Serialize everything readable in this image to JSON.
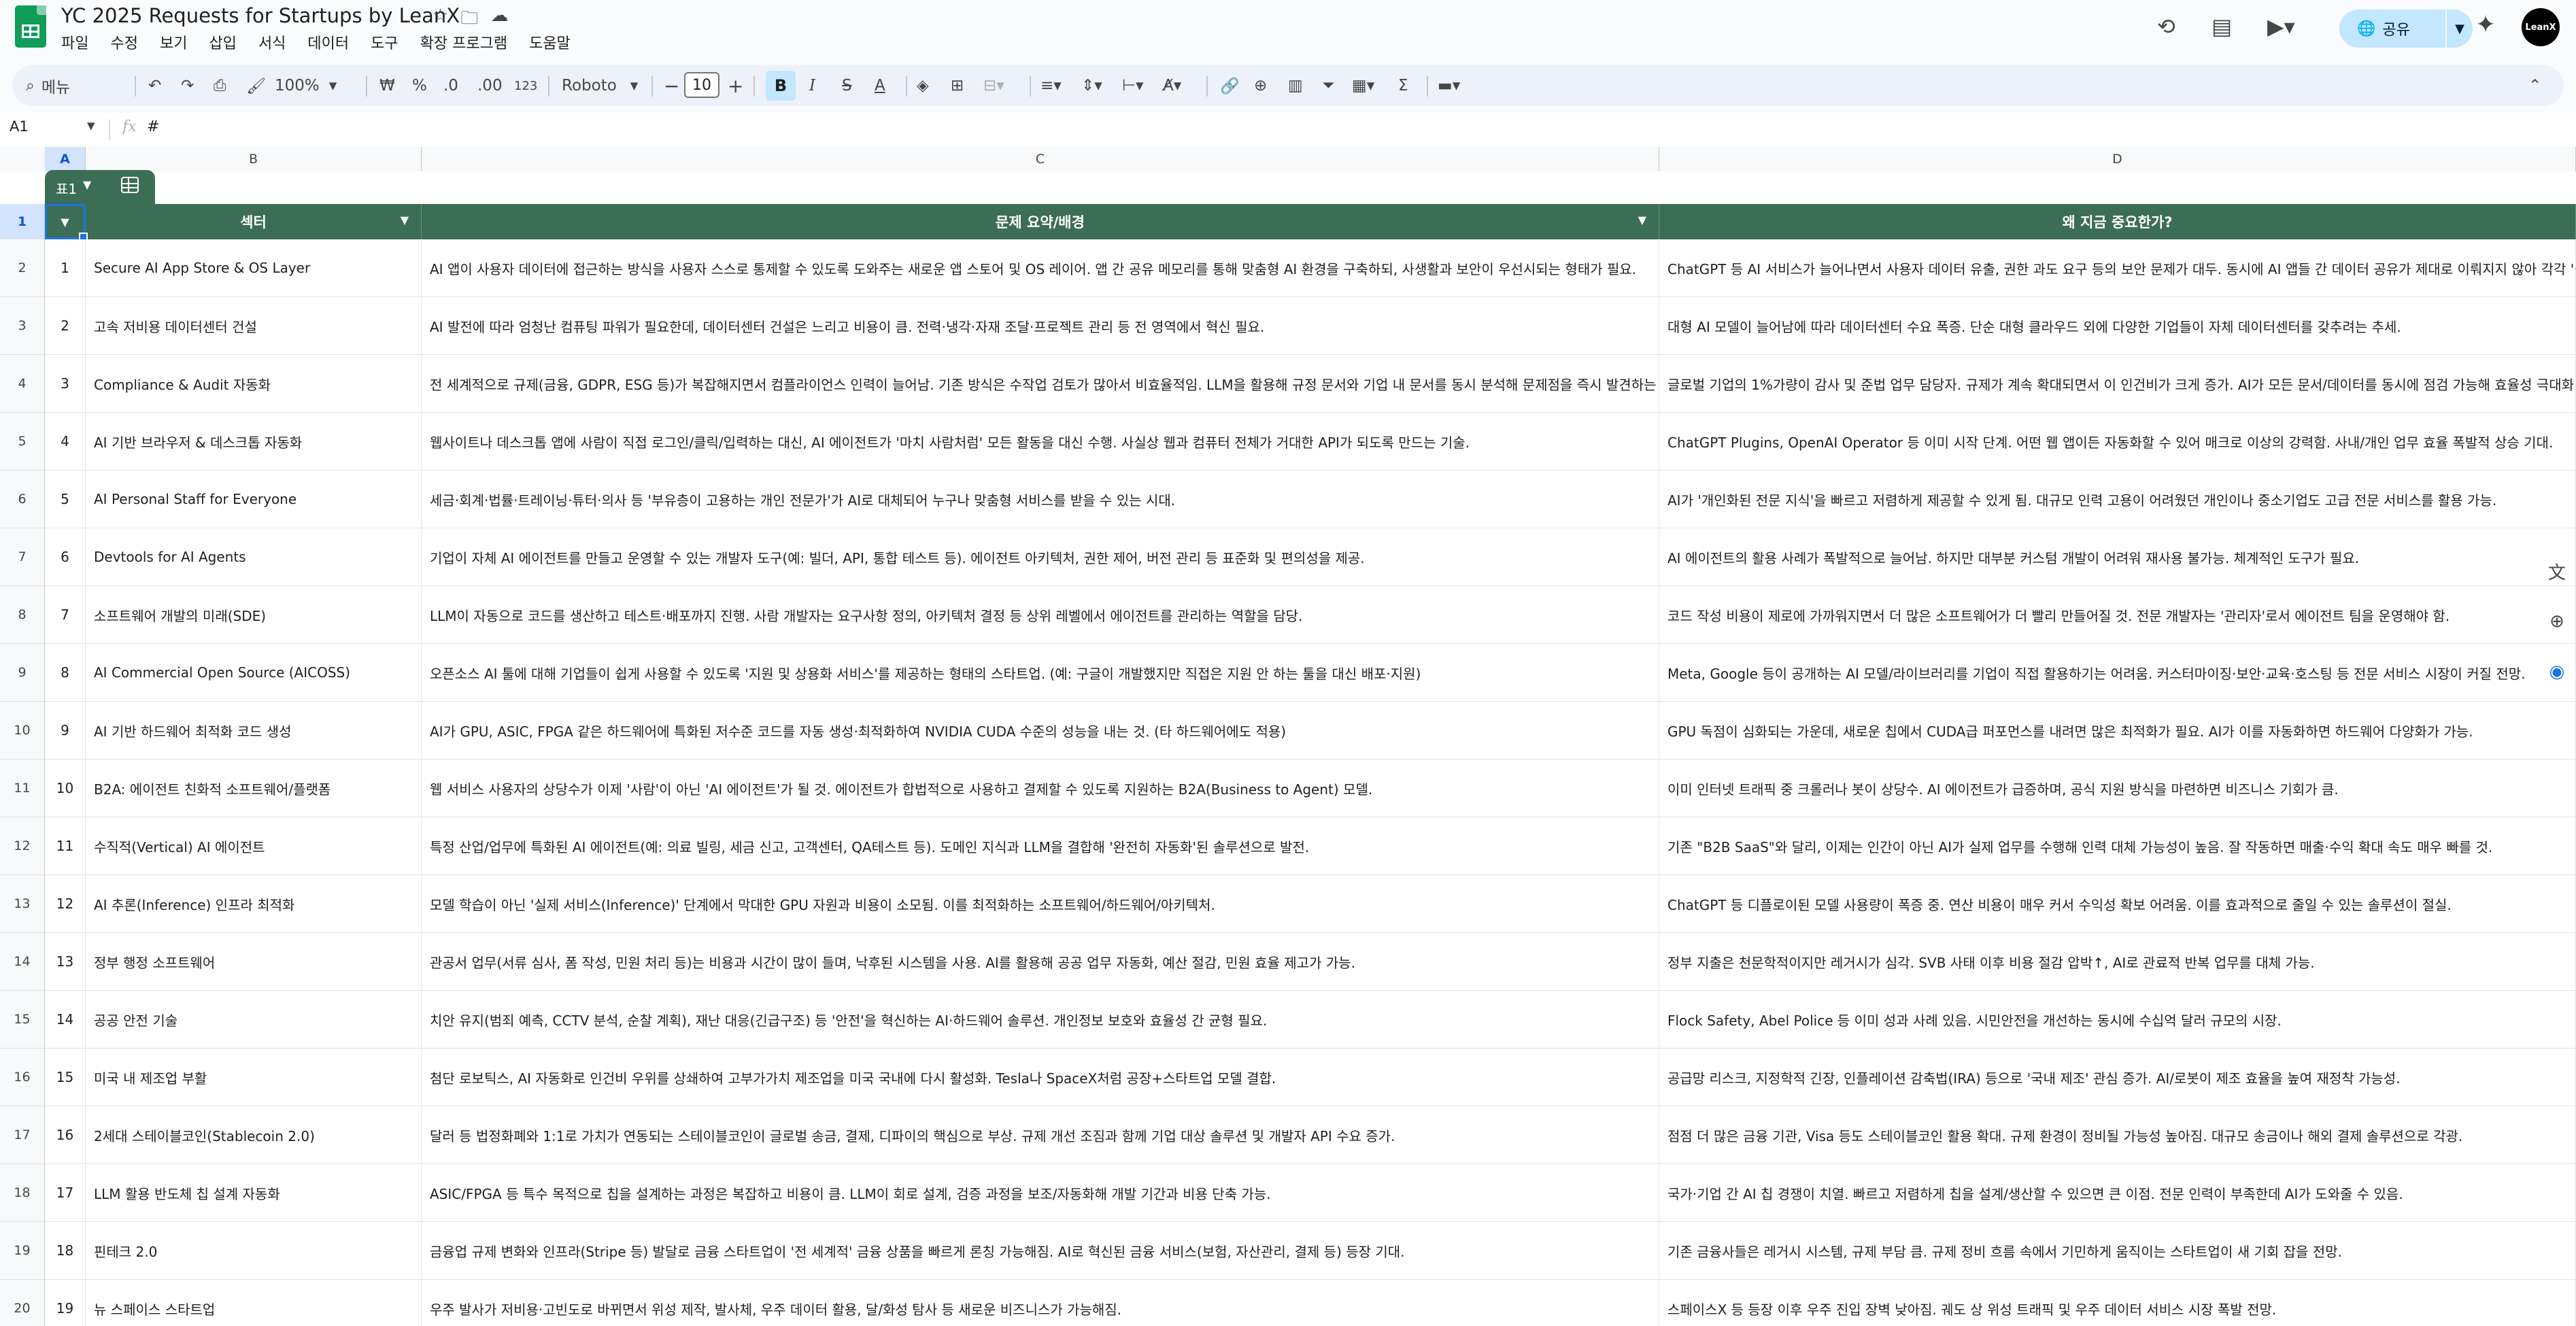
{
  "document": {
    "title": "YC 2025 Requests for Startups by LeanX",
    "menu": [
      "파일",
      "수정",
      "보기",
      "삽입",
      "서식",
      "데이터",
      "도구",
      "확장 프로그램",
      "도움말"
    ]
  },
  "header_right": {
    "share_label": "공유",
    "avatar_text": "LeanX"
  },
  "toolbar": {
    "search_placeholder": "메뉴",
    "zoom": "100%",
    "currency": "₩",
    "percent": "%",
    "dec_decrease": ".0",
    "dec_increase": ".00",
    "number_format": "123",
    "font_name": "Roboto",
    "font_size": "10",
    "bold": "B",
    "italic": "I",
    "strike": "S",
    "text_color": "A"
  },
  "formula_bar": {
    "cell_ref": "A1",
    "fx": "fx",
    "value": "#"
  },
  "columns": [
    "A",
    "B",
    "C",
    "D"
  ],
  "table": {
    "chip_name": "표1",
    "headers": {
      "num": "#",
      "sector": "섹터",
      "summary": "문제 요약/배경",
      "why_now": "왜 지금 중요한가?"
    },
    "row_numbers": [
      "1",
      "2",
      "3",
      "4",
      "5",
      "6",
      "7",
      "8",
      "9",
      "10",
      "11",
      "12",
      "13",
      "14",
      "15",
      "16",
      "17",
      "18",
      "19",
      "20"
    ],
    "rows": [
      {
        "num": "1",
        "sector": "Secure AI App Store & OS Layer",
        "summary": "AI 앱이 사용자 데이터에 접근하는 방식을 사용자 스스로 통제할 수 있도록 도와주는 새로운 앱 스토어 및 OS 레이어. 앱 간 공유 메모리를 통해 맞춤형 AI 환경을 구축하되, 사생활과 보안이 우선시되는 형태가 필요.",
        "why": "ChatGPT 등 AI 서비스가 늘어나면서 사용자 데이터 유출, 권한 과도 요구 등의 보안 문제가 대두. 동시에 AI 앱들 간 데이터 공유가 제대로 이뤄지지 않아 각각 '섬'처럼 동작."
      },
      {
        "num": "2",
        "sector": "고속 저비용 데이터센터 건설",
        "summary": "AI 발전에 따라 엄청난 컴퓨팅 파워가 필요한데, 데이터센터 건설은 느리고 비용이 큼. 전력·냉각·자재 조달·프로젝트 관리 등 전 영역에서 혁신 필요.",
        "why": "대형 AI 모델이 늘어남에 따라 데이터센터 수요 폭증. 단순 대형 클라우드 외에 다양한 기업들이 자체 데이터센터를 갖추려는 추세."
      },
      {
        "num": "3",
        "sector": "Compliance & Audit 자동화",
        "summary": "전 세계적으로 규제(금융, GDPR, ESG 등)가 복잡해지면서 컴플라이언스 인력이 늘어남. 기존 방식은 수작업 검토가 많아서 비효율적임. LLM을 활용해 규정 문서와 기업 내 문서를 동시 분석해 문제점을 즉시 발견하는 자동화 필요.",
        "why": "글로벌 기업의 1%가량이 감사 및 준법 업무 담당자. 규제가 계속 확대되면서 이 인건비가 크게 증가. AI가 모든 문서/데이터를 동시에 점검 가능해 효율성 극대화."
      },
      {
        "num": "4",
        "sector": "AI 기반 브라우저 & 데스크톱 자동화",
        "summary": "웹사이트나 데스크톱 앱에 사람이 직접 로그인/클릭/입력하는 대신, AI 에이전트가 '마치 사람처럼' 모든 활동을 대신 수행. 사실상 웹과 컴퓨터 전체가 거대한 API가 되도록 만드는 기술.",
        "why": "ChatGPT Plugins, OpenAI Operator 등 이미 시작 단계. 어떤 웹 앱이든 자동화할 수 있어 매크로 이상의 강력함. 사내/개인 업무 효율 폭발적 상승 기대."
      },
      {
        "num": "5",
        "sector": "AI Personal Staff for Everyone",
        "summary": "세금·회계·법률·트레이닝·튜터·의사 등 '부유층이 고용하는 개인 전문가'가 AI로 대체되어 누구나 맞춤형 서비스를 받을 수 있는 시대.",
        "why": "AI가 '개인화된 전문 지식'을 빠르고 저렴하게 제공할 수 있게 됨. 대규모 인력 고용이 어려웠던 개인이나 중소기업도 고급 전문 서비스를 활용 가능."
      },
      {
        "num": "6",
        "sector": "Devtools for AI Agents",
        "summary": "기업이 자체 AI 에이전트를 만들고 운영할 수 있는 개발자 도구(예: 빌더, API, 통합 테스트 등). 에이전트 아키텍처, 권한 제어, 버전 관리 등 표준화 및 편의성을 제공.",
        "why": "AI 에이전트의 활용 사례가 폭발적으로 늘어남. 하지만 대부분 커스텀 개발이 어려워 재사용 불가능. 체계적인 도구가 필요."
      },
      {
        "num": "7",
        "sector": "소프트웨어 개발의 미래(SDE)",
        "summary": "LLM이 자동으로 코드를 생산하고 테스트·배포까지 진행. 사람 개발자는 요구사항 정의, 아키텍처 결정 등 상위 레벨에서 에이전트를 관리하는 역할을 담당.",
        "why": "코드 작성 비용이 제로에 가까워지면서 더 많은 소프트웨어가 더 빨리 만들어질 것. 전문 개발자는 '관리자'로서 에이전트 팀을 운영해야 함."
      },
      {
        "num": "8",
        "sector": "AI Commercial Open Source (AICOSS)",
        "summary": "오픈소스 AI 툴에 대해 기업들이 쉽게 사용할 수 있도록 '지원 및 상용화 서비스'를 제공하는 형태의 스타트업. (예: 구글이 개발했지만 직접은 지원 안 하는 툴을 대신 배포·지원)",
        "why": "Meta, Google 등이 공개하는 AI 모델/라이브러리를 기업이 직접 활용하기는 어려움. 커스터마이징·보안·교육·호스팅 등 전문 서비스 시장이 커질 전망."
      },
      {
        "num": "9",
        "sector": "AI 기반 하드웨어 최적화 코드 생성",
        "summary": "AI가 GPU, ASIC, FPGA 같은 하드웨어에 특화된 저수준 코드를 자동 생성·최적화하여 NVIDIA CUDA 수준의 성능을 내는 것. (타 하드웨어에도 적용)",
        "why": "GPU 독점이 심화되는 가운데, 새로운 칩에서 CUDA급 퍼포먼스를 내려면 많은 최적화가 필요. AI가 이를 자동화하면 하드웨어 다양화가 가능."
      },
      {
        "num": "10",
        "sector": "B2A: 에이전트 친화적 소프트웨어/플랫폼",
        "summary": "웹 서비스 사용자의 상당수가 이제 '사람'이 아닌 'AI 에이전트'가 될 것. 에이전트가 합법적으로 사용하고 결제할 수 있도록 지원하는 B2A(Business to Agent) 모델.",
        "why": "이미 인터넷 트래픽 중 크롤러나 봇이 상당수. AI 에이전트가 급증하며, 공식 지원 방식을 마련하면 비즈니스 기회가 큼."
      },
      {
        "num": "11",
        "sector": "수직적(Vertical) AI 에이전트",
        "summary": "특정 산업/업무에 특화된 AI 에이전트(예: 의료 빌링, 세금 신고, 고객센터, QA테스트 등). 도메인 지식과 LLM을 결합해 '완전히 자동화'된 솔루션으로 발전.",
        "why": "기존 \"B2B SaaS\"와 달리, 이제는 인간이 아닌 AI가 실제 업무를 수행해 인력 대체 가능성이 높음. 잘 작동하면 매출·수익 확대 속도 매우 빠를 것."
      },
      {
        "num": "12",
        "sector": "AI 추론(Inference) 인프라 최적화",
        "summary": "모델 학습이 아닌 '실제 서비스(Inference)' 단계에서 막대한 GPU 자원과 비용이 소모됨. 이를 최적화하는 소프트웨어/하드웨어/아키텍처.",
        "why": "ChatGPT 등 디플로이된 모델 사용량이 폭증 중. 연산 비용이 매우 커서 수익성 확보 어려움. 이를 효과적으로 줄일 수 있는 솔루션이 절실."
      },
      {
        "num": "13",
        "sector": "정부 행정 소프트웨어",
        "summary": "관공서 업무(서류 심사, 폼 작성, 민원 처리 등)는 비용과 시간이 많이 들며, 낙후된 시스템을 사용. AI를 활용해 공공 업무 자동화, 예산 절감, 민원 효율 제고가 가능.",
        "why": "정부 지출은 천문학적이지만 레거시가 심각. SVB 사태 이후 비용 절감 압박↑, AI로 관료적 반복 업무를 대체 가능."
      },
      {
        "num": "14",
        "sector": "공공 안전 기술",
        "summary": "치안 유지(범죄 예측, CCTV 분석, 순찰 계획), 재난 대응(긴급구조) 등 '안전'을 혁신하는 AI·하드웨어 솔루션. 개인정보 보호와 효율성 간 균형 필요.",
        "why": "Flock Safety, Abel Police 등 이미 성과 사례 있음. 시민안전을 개선하는 동시에 수십억 달러 규모의 시장."
      },
      {
        "num": "15",
        "sector": "미국 내 제조업 부활",
        "summary": "첨단 로보틱스, AI 자동화로 인건비 우위를 상쇄하여 고부가가치 제조업을 미국 국내에 다시 활성화. Tesla나 SpaceX처럼 공장+스타트업 모델 결합.",
        "why": "공급망 리스크, 지정학적 긴장, 인플레이션 감축법(IRA) 등으로 '국내 제조' 관심 증가. AI/로봇이 제조 효율을 높여 재정착 가능성."
      },
      {
        "num": "16",
        "sector": "2세대 스테이블코인(Stablecoin 2.0)",
        "summary": "달러 등 법정화폐와 1:1로 가치가 연동되는 스테이블코인이 글로벌 송금, 결제, 디파이의 핵심으로 부상. 규제 개선 조짐과 함께 기업 대상 솔루션 및 개발자 API 수요 증가.",
        "why": "점점 더 많은 금융 기관, Visa 등도 스테이블코인 활용 확대. 규제 환경이 정비될 가능성 높아짐. 대규모 송금이나 해외 결제 솔루션으로 각광."
      },
      {
        "num": "17",
        "sector": "LLM 활용 반도체 칩 설계 자동화",
        "summary": "ASIC/FPGA 등 특수 목적으로 칩을 설계하는 과정은 복잡하고 비용이 큼. LLM이 회로 설계, 검증 과정을 보조/자동화해 개발 기간과 비용 단축 가능.",
        "why": "국가·기업 간 AI 칩 경쟁이 치열. 빠르고 저렴하게 칩을 설계/생산할 수 있으면 큰 이점. 전문 인력이 부족한데 AI가 도와줄 수 있음."
      },
      {
        "num": "18",
        "sector": "핀테크 2.0",
        "summary": "금융업 규제 변화와 인프라(Stripe 등) 발달로 금융 스타트업이 '전 세계적' 금융 상품을 빠르게 론칭 가능해짐. AI로 혁신된 금융 서비스(보험, 자산관리, 결제 등) 등장 기대.",
        "why": "기존 금융사들은 레거시 시스템, 규제 부담 큼. 규제 정비 흐름 속에서 기민하게 움직이는 스타트업이 새 기회 잡을 전망."
      },
      {
        "num": "19",
        "sector": "뉴 스페이스 스타트업",
        "summary": "우주 발사가 저비용·고빈도로 바뀌면서 위성 제작, 발사체, 우주 데이터 활용, 달/화성 탐사 등 새로운 비즈니스가 가능해짐.",
        "why": "스페이스X 등 등장 이후 우주 진입 장벽 낮아짐. 궤도 상 위성 트래픽 및 우주 데이터 서비스 시장 폭발 전망."
      }
    ]
  },
  "colors": {
    "header_bg": "#3c6e55",
    "share_bg": "#c2e7ff",
    "selection": "#1a73e8"
  }
}
